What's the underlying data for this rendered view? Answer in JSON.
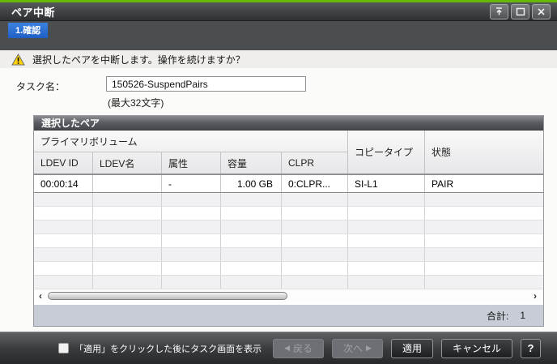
{
  "window": {
    "title": "ペア中断"
  },
  "step_tab": {
    "label": "1.確認"
  },
  "warning": {
    "message": "選択したペアを中断します。操作を続けますか？"
  },
  "task_name": {
    "label": "タスク名：",
    "value": "150526-SuspendPairs",
    "note": "(最大32文字)"
  },
  "pairs_table": {
    "title": "選択したペア",
    "group_header": "プライマリボリューム",
    "columns": {
      "ldev_id": "LDEV ID",
      "ldev_name": "LDEV名",
      "attribute": "属性",
      "capacity": "容量",
      "clpr": "CLPR",
      "copy_type": "コピータイプ",
      "status": "状態"
    },
    "rows": [
      {
        "ldev_id": "00:00:14",
        "ldev_name": "",
        "attribute": "-",
        "capacity": "1.00 GB",
        "clpr": "0:CLPR...",
        "copy_type": "SI-L1",
        "status": "PAIR"
      }
    ],
    "scrollbar": {
      "left_arrow": "‹",
      "right_arrow": "›"
    },
    "total_label": "合計:",
    "total_value": "1"
  },
  "action_bar": {
    "checkbox_label": "「適用」をクリックした後にタスク画面を表示",
    "back_arrow": "◀",
    "back_label": "戻る",
    "next_label": "次へ",
    "next_arrow": "▶",
    "apply_label": "適用",
    "cancel_label": "キャンセル",
    "help_label": "?"
  }
}
